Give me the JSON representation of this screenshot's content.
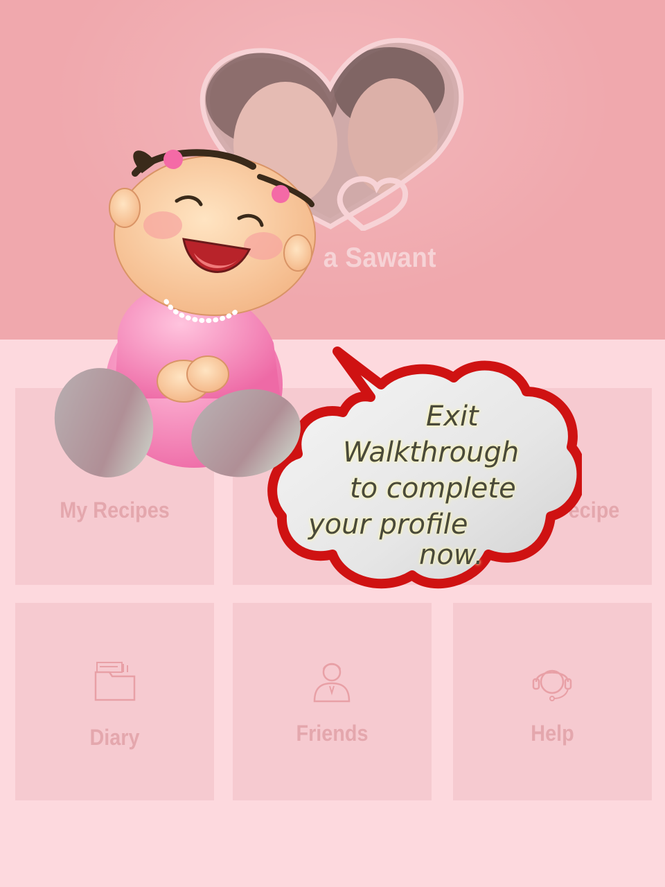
{
  "header": {
    "profile_name": "a Sawant",
    "background_color": "#f0a8ad"
  },
  "tiles": [
    {
      "label": "My Recipes",
      "icon": "book-icon"
    },
    {
      "label": "",
      "icon": ""
    },
    {
      "label": "ecipe",
      "icon": ""
    },
    {
      "label": "Diary",
      "icon": "folder-icon"
    },
    {
      "label": "Friends",
      "icon": "person-icon"
    },
    {
      "label": "Help",
      "icon": "headset-icon"
    }
  ],
  "walkthrough": {
    "mascot": "baby-girl-icon",
    "bubble_lines": [
      "Exit",
      "Walkthrough",
      "to complete",
      "your profile",
      "now."
    ]
  },
  "colors": {
    "tile_bg": "#f6cad0",
    "page_bg": "#fdd9de",
    "bubble_border": "#d21414",
    "label_color": "#e4a7ad"
  }
}
